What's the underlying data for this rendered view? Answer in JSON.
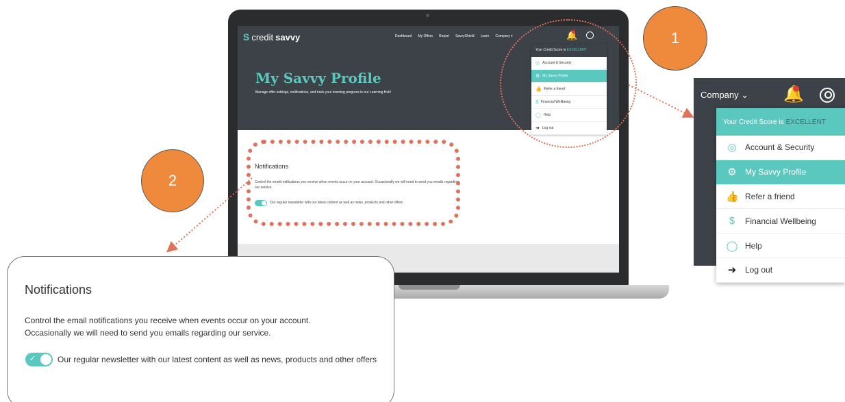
{
  "badges": {
    "one": "1",
    "two": "2"
  },
  "screen": {
    "logo_prefix": "credit",
    "logo_suffix": "savvy",
    "nav": [
      "Dashboard",
      "My Offers",
      "Report",
      "SavvyShield",
      "Learn",
      "Company ▾"
    ],
    "title": "My Savvy Profile",
    "subtitle": "Manage offer settings, notifications, and track your learning progress in our Learning Hub!",
    "notifications_title": "Notifications",
    "notifications_desc": "Control the email notifications you receive when events occur on your account. Occasionally we will need to send you emails regarding our service.",
    "newsletter_label": "Our regular newsletter with our latest content as well as news, products and other offers"
  },
  "menu": {
    "header_prefix": "Your Credit Score is",
    "header_value": "EXCELLENT",
    "items": [
      {
        "label": "Account & Security",
        "icon": "user-circle-icon"
      },
      {
        "label": "My Savvy Profile",
        "icon": "gear-icon",
        "active": true
      },
      {
        "label": "Refer a friend",
        "icon": "thumbs-up-icon"
      },
      {
        "label": "Financial Wellbeing",
        "icon": "hand-dollar-icon"
      },
      {
        "label": "Help",
        "icon": "speech-bubble-icon"
      },
      {
        "label": "Log out",
        "icon": "logout-icon"
      }
    ]
  },
  "zoom_right": {
    "company": "Company ⌄"
  },
  "zoom_left": {
    "title": "Notifications",
    "desc_line1": "Control the email notifications you receive when events occur on your account.",
    "desc_line2": "Occasionally we will need to send you emails regarding our service.",
    "newsletter_label": "Our regular newsletter with our latest content as well as news, products and other offers",
    "newsletter_on": true
  },
  "colors": {
    "brand_teal": "#5bc8c0",
    "header_dark": "#3c4247",
    "accent_orange": "#ef8a3c",
    "dotted_red": "#e0715a"
  }
}
